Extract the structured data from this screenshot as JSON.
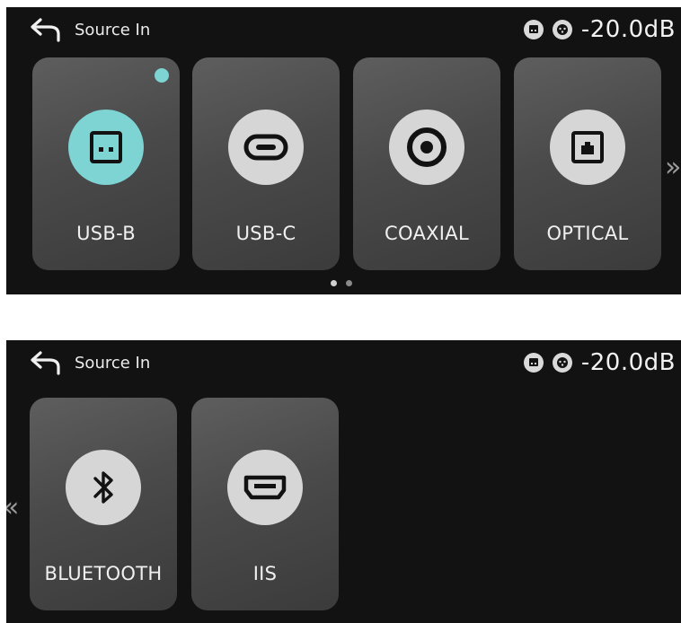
{
  "screens": [
    {
      "header": {
        "title": "Source In",
        "volume": "-20.0dB",
        "status_icons": [
          "usb-b-status-icon",
          "xlr-status-icon"
        ]
      },
      "cards": [
        {
          "label": "USB-B",
          "icon": "usb-b-icon",
          "active": true
        },
        {
          "label": "USB-C",
          "icon": "usb-c-icon",
          "active": false
        },
        {
          "label": "COAXIAL",
          "icon": "coaxial-icon",
          "active": false
        },
        {
          "label": "OPTICAL",
          "icon": "optical-icon",
          "active": false
        }
      ],
      "next_arrow": "»",
      "pagination": {
        "pages": 2,
        "current": 1
      }
    },
    {
      "header": {
        "title": "Source In",
        "volume": "-20.0dB",
        "status_icons": [
          "usb-b-status-icon",
          "xlr-status-icon"
        ]
      },
      "cards": [
        {
          "label": "BLUETOOTH",
          "icon": "bluetooth-icon",
          "active": false
        },
        {
          "label": "IIS",
          "icon": "hdmi-icon",
          "active": false
        }
      ],
      "prev_arrow": "«"
    }
  ],
  "colors": {
    "background": "#121212",
    "card": "#4a4a4a",
    "icon_circle": "#d6d6d6",
    "accent": "#7ed3d3",
    "dot_active": "#d0d0d0",
    "dot_inactive": "#8a8a8a"
  }
}
